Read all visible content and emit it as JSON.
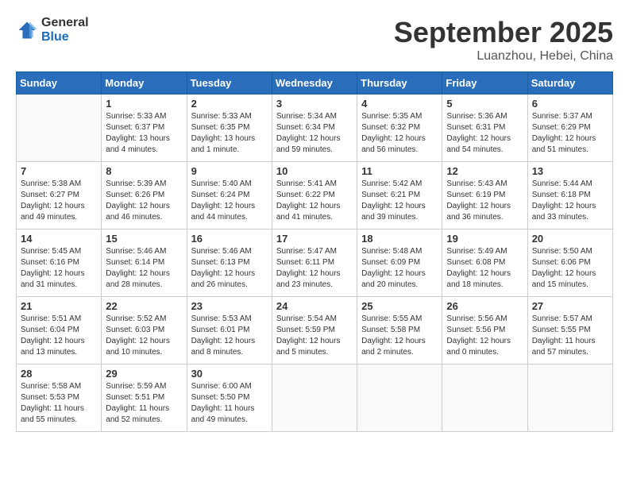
{
  "header": {
    "logo_general": "General",
    "logo_blue": "Blue",
    "title": "September 2025",
    "subtitle": "Luanzhou, Hebei, China"
  },
  "days_of_week": [
    "Sunday",
    "Monday",
    "Tuesday",
    "Wednesday",
    "Thursday",
    "Friday",
    "Saturday"
  ],
  "weeks": [
    [
      {
        "day": "",
        "info": ""
      },
      {
        "day": "1",
        "info": "Sunrise: 5:33 AM\nSunset: 6:37 PM\nDaylight: 13 hours\nand 4 minutes."
      },
      {
        "day": "2",
        "info": "Sunrise: 5:33 AM\nSunset: 6:35 PM\nDaylight: 13 hours\nand 1 minute."
      },
      {
        "day": "3",
        "info": "Sunrise: 5:34 AM\nSunset: 6:34 PM\nDaylight: 12 hours\nand 59 minutes."
      },
      {
        "day": "4",
        "info": "Sunrise: 5:35 AM\nSunset: 6:32 PM\nDaylight: 12 hours\nand 56 minutes."
      },
      {
        "day": "5",
        "info": "Sunrise: 5:36 AM\nSunset: 6:31 PM\nDaylight: 12 hours\nand 54 minutes."
      },
      {
        "day": "6",
        "info": "Sunrise: 5:37 AM\nSunset: 6:29 PM\nDaylight: 12 hours\nand 51 minutes."
      }
    ],
    [
      {
        "day": "7",
        "info": "Sunrise: 5:38 AM\nSunset: 6:27 PM\nDaylight: 12 hours\nand 49 minutes."
      },
      {
        "day": "8",
        "info": "Sunrise: 5:39 AM\nSunset: 6:26 PM\nDaylight: 12 hours\nand 46 minutes."
      },
      {
        "day": "9",
        "info": "Sunrise: 5:40 AM\nSunset: 6:24 PM\nDaylight: 12 hours\nand 44 minutes."
      },
      {
        "day": "10",
        "info": "Sunrise: 5:41 AM\nSunset: 6:22 PM\nDaylight: 12 hours\nand 41 minutes."
      },
      {
        "day": "11",
        "info": "Sunrise: 5:42 AM\nSunset: 6:21 PM\nDaylight: 12 hours\nand 39 minutes."
      },
      {
        "day": "12",
        "info": "Sunrise: 5:43 AM\nSunset: 6:19 PM\nDaylight: 12 hours\nand 36 minutes."
      },
      {
        "day": "13",
        "info": "Sunrise: 5:44 AM\nSunset: 6:18 PM\nDaylight: 12 hours\nand 33 minutes."
      }
    ],
    [
      {
        "day": "14",
        "info": "Sunrise: 5:45 AM\nSunset: 6:16 PM\nDaylight: 12 hours\nand 31 minutes."
      },
      {
        "day": "15",
        "info": "Sunrise: 5:46 AM\nSunset: 6:14 PM\nDaylight: 12 hours\nand 28 minutes."
      },
      {
        "day": "16",
        "info": "Sunrise: 5:46 AM\nSunset: 6:13 PM\nDaylight: 12 hours\nand 26 minutes."
      },
      {
        "day": "17",
        "info": "Sunrise: 5:47 AM\nSunset: 6:11 PM\nDaylight: 12 hours\nand 23 minutes."
      },
      {
        "day": "18",
        "info": "Sunrise: 5:48 AM\nSunset: 6:09 PM\nDaylight: 12 hours\nand 20 minutes."
      },
      {
        "day": "19",
        "info": "Sunrise: 5:49 AM\nSunset: 6:08 PM\nDaylight: 12 hours\nand 18 minutes."
      },
      {
        "day": "20",
        "info": "Sunrise: 5:50 AM\nSunset: 6:06 PM\nDaylight: 12 hours\nand 15 minutes."
      }
    ],
    [
      {
        "day": "21",
        "info": "Sunrise: 5:51 AM\nSunset: 6:04 PM\nDaylight: 12 hours\nand 13 minutes."
      },
      {
        "day": "22",
        "info": "Sunrise: 5:52 AM\nSunset: 6:03 PM\nDaylight: 12 hours\nand 10 minutes."
      },
      {
        "day": "23",
        "info": "Sunrise: 5:53 AM\nSunset: 6:01 PM\nDaylight: 12 hours\nand 8 minutes."
      },
      {
        "day": "24",
        "info": "Sunrise: 5:54 AM\nSunset: 5:59 PM\nDaylight: 12 hours\nand 5 minutes."
      },
      {
        "day": "25",
        "info": "Sunrise: 5:55 AM\nSunset: 5:58 PM\nDaylight: 12 hours\nand 2 minutes."
      },
      {
        "day": "26",
        "info": "Sunrise: 5:56 AM\nSunset: 5:56 PM\nDaylight: 12 hours\nand 0 minutes."
      },
      {
        "day": "27",
        "info": "Sunrise: 5:57 AM\nSunset: 5:55 PM\nDaylight: 11 hours\nand 57 minutes."
      }
    ],
    [
      {
        "day": "28",
        "info": "Sunrise: 5:58 AM\nSunset: 5:53 PM\nDaylight: 11 hours\nand 55 minutes."
      },
      {
        "day": "29",
        "info": "Sunrise: 5:59 AM\nSunset: 5:51 PM\nDaylight: 11 hours\nand 52 minutes."
      },
      {
        "day": "30",
        "info": "Sunrise: 6:00 AM\nSunset: 5:50 PM\nDaylight: 11 hours\nand 49 minutes."
      },
      {
        "day": "",
        "info": ""
      },
      {
        "day": "",
        "info": ""
      },
      {
        "day": "",
        "info": ""
      },
      {
        "day": "",
        "info": ""
      }
    ]
  ]
}
